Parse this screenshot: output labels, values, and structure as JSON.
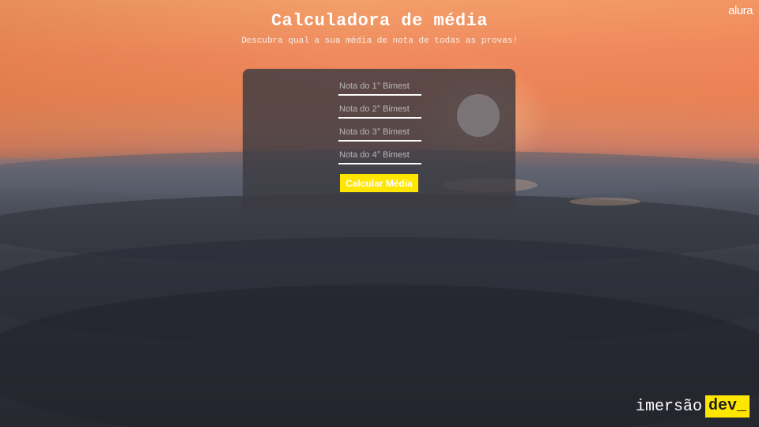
{
  "header": {
    "title": "Calculadora de média",
    "subtitle": "Descubra qual a sua média de nota de todas as provas!"
  },
  "brand": {
    "top_right_logo": "alura"
  },
  "form": {
    "fields": [
      {
        "placeholder": "Nota do 1° Bimest",
        "value": ""
      },
      {
        "placeholder": "Nota do 2° Bimest",
        "value": ""
      },
      {
        "placeholder": "Nota do 3° Bimest",
        "value": ""
      },
      {
        "placeholder": "Nota do 4° Bimest",
        "value": ""
      }
    ],
    "submit_label": "Calcular Média"
  },
  "footer": {
    "logo_word": "imersão",
    "logo_badge": "dev_"
  },
  "colors": {
    "accent": "#ffe600",
    "card": "#3c3a42",
    "text": "#ffffff"
  }
}
